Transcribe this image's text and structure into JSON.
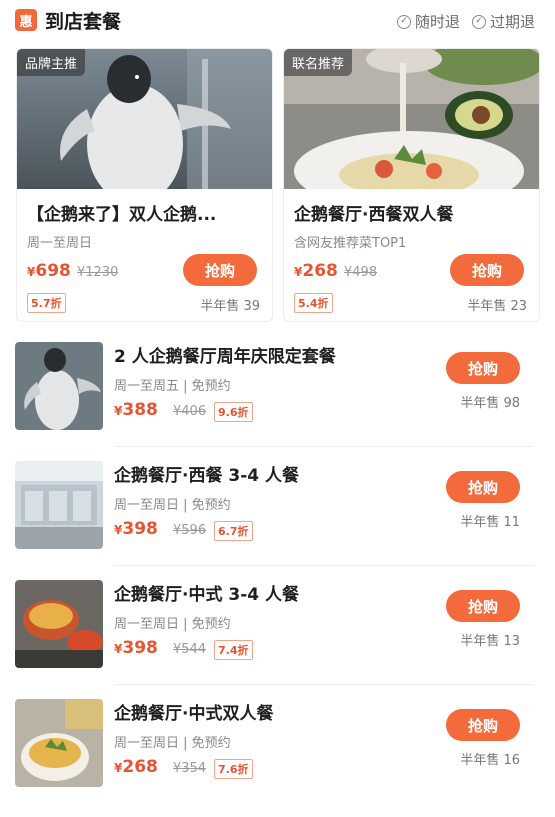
{
  "header": {
    "badge": "惠",
    "title": "到店套餐",
    "flags": [
      "随时退",
      "过期退"
    ]
  },
  "top_cards": [
    {
      "tag": "品牌主推",
      "title": "【企鹅来了】双人企鹅...",
      "subtitle": "周一至周日",
      "price_symbol": "¥",
      "price": "698",
      "original_price": "¥1230",
      "discount": "5.7折",
      "button": "抢购",
      "sold": "半年售 39"
    },
    {
      "tag": "联名推荐",
      "title": "企鹅餐厅·西餐双人餐",
      "subtitle": "含网友推荐菜TOP1",
      "price_symbol": "¥",
      "price": "268",
      "original_price": "¥498",
      "discount": "5.4折",
      "button": "抢购",
      "sold": "半年售 23"
    }
  ],
  "rows": [
    {
      "title": "2 人企鹅餐厅周年庆限定套餐",
      "subtitle": "周一至周五 | 免预约",
      "price_symbol": "¥",
      "price": "388",
      "original_price": "¥406",
      "discount": "9.6折",
      "button": "抢购",
      "sold": "半年售 98"
    },
    {
      "title": "企鹅餐厅·西餐 3-4 人餐",
      "subtitle": "周一至周日 | 免预约",
      "price_symbol": "¥",
      "price": "398",
      "original_price": "¥596",
      "discount": "6.7折",
      "button": "抢购",
      "sold": "半年售 11"
    },
    {
      "title": "企鹅餐厅·中式 3-4 人餐",
      "subtitle": "周一至周日 | 免预约",
      "price_symbol": "¥",
      "price": "398",
      "original_price": "¥544",
      "discount": "7.4折",
      "button": "抢购",
      "sold": "半年售 13"
    },
    {
      "title": "企鹅餐厅·中式双人餐",
      "subtitle": "周一至周日 | 免预约",
      "price_symbol": "¥",
      "price": "268",
      "original_price": "¥354",
      "discount": "7.6折",
      "button": "抢购",
      "sold": "半年售 16"
    }
  ],
  "colors": {
    "accent": "#f36b3c",
    "price": "#e8542f"
  }
}
